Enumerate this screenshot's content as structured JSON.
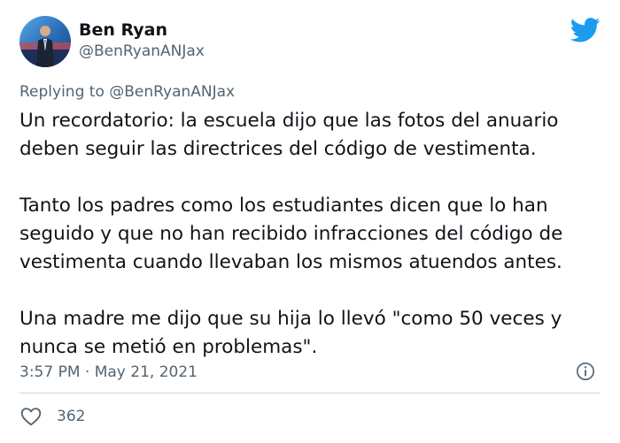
{
  "author": {
    "display_name": "Ben Ryan",
    "handle": "@BenRyanANJax"
  },
  "reply": {
    "prefix": "Replying to ",
    "mention": "@BenRyanANJax"
  },
  "tweet": {
    "paragraphs": [
      "Un recordatorio: la escuela dijo que las fotos del anuario\ndeben seguir las directrices del código de vestimenta.",
      "Tanto los padres como los estudiantes dicen que lo han\nseguido y que no han recibido infracciones del código de\nvestimenta cuando llevaban los mismos atuendos antes.",
      "Una madre me dijo que su hija lo llevó \"como 50 veces y\nnunca se metió en problemas\"."
    ]
  },
  "meta": {
    "time": "3:57 PM",
    "separator": " · ",
    "date": "May 21, 2021"
  },
  "engagement": {
    "likes": "362"
  },
  "icons": {
    "brand": "twitter-bird-icon",
    "info": "info-icon",
    "like": "heart-icon"
  },
  "colors": {
    "brand": "#1d9bf0",
    "text": "#0f1419",
    "secondary": "#536471",
    "divider": "#cfd9de"
  }
}
